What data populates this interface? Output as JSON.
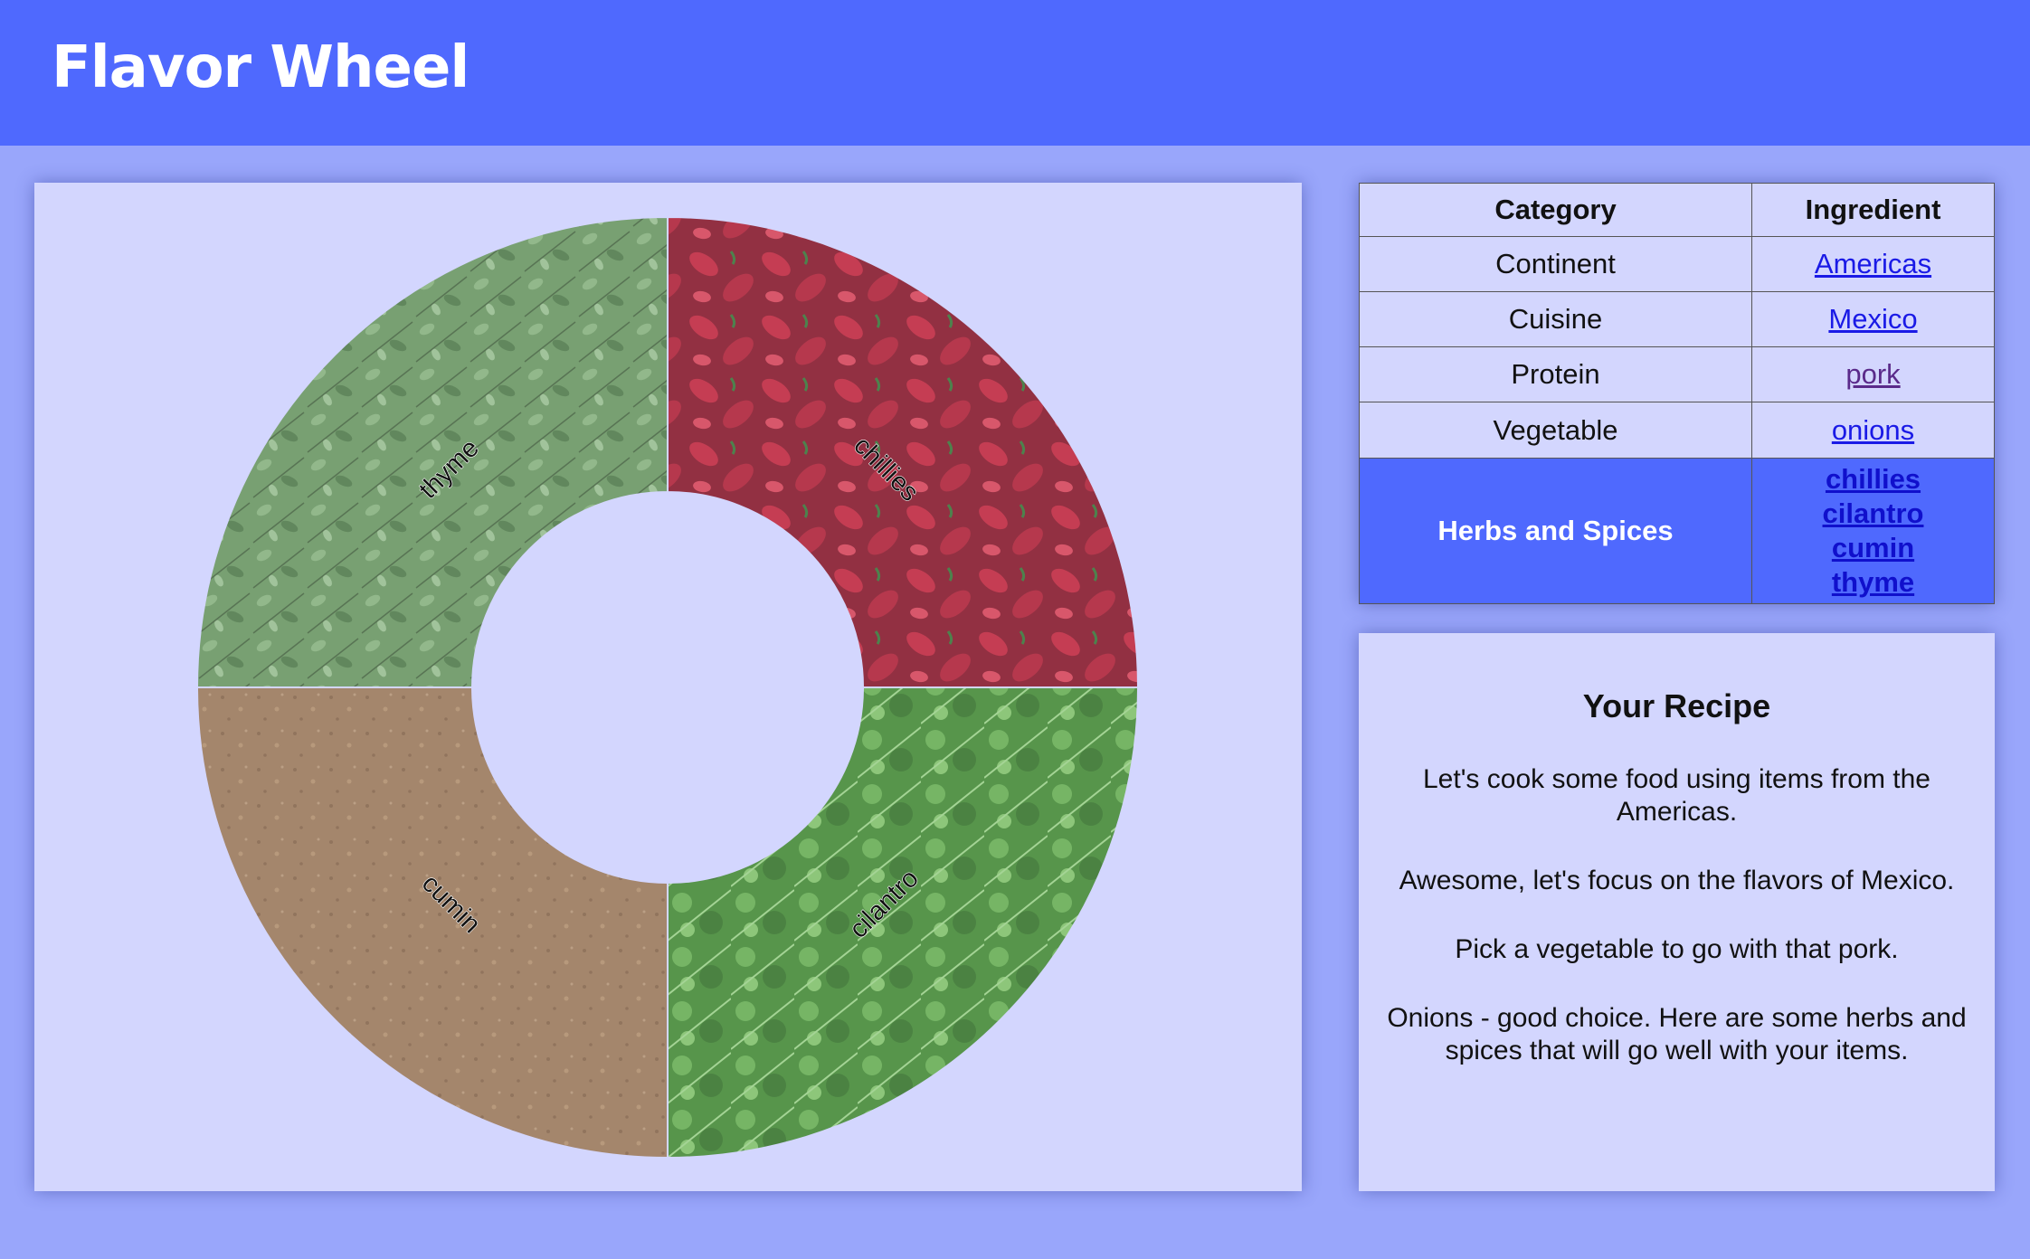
{
  "app": {
    "title": "Flavor Wheel"
  },
  "wheel": {
    "segments": [
      {
        "label": "thyme",
        "color": "#5e8d55"
      },
      {
        "label": "chillies",
        "color": "#a3273a"
      },
      {
        "label": "cilantro",
        "color": "#4d9a3c"
      },
      {
        "label": "cumin",
        "color": "#9c7b5b"
      }
    ]
  },
  "table": {
    "headers": {
      "category": "Category",
      "ingredient": "Ingredient"
    },
    "rows": [
      {
        "category": "Continent",
        "ingredient": "Americas"
      },
      {
        "category": "Cuisine",
        "ingredient": "Mexico"
      },
      {
        "category": "Protein",
        "ingredient": "pork"
      },
      {
        "category": "Vegetable",
        "ingredient": "onions"
      }
    ],
    "active_row": {
      "category": "Herbs and Spices",
      "ingredients": [
        "chillies",
        "cilantro",
        "cumin",
        "thyme"
      ]
    }
  },
  "recipe": {
    "title": "Your Recipe",
    "paragraphs": [
      "Let's cook some food using items from the Americas.",
      "Awesome, let's focus on the flavors of Mexico.",
      "Pick a vegetable to go with that pork.",
      "Onions - good choice. Here are some herbs and spices that will go well with your items."
    ]
  },
  "colors": {
    "header": "#4f69fe",
    "background": "#99a6fb",
    "panel": "#d3d6fe",
    "active_row": "#4f69fe",
    "link": "#1a1ae6"
  }
}
